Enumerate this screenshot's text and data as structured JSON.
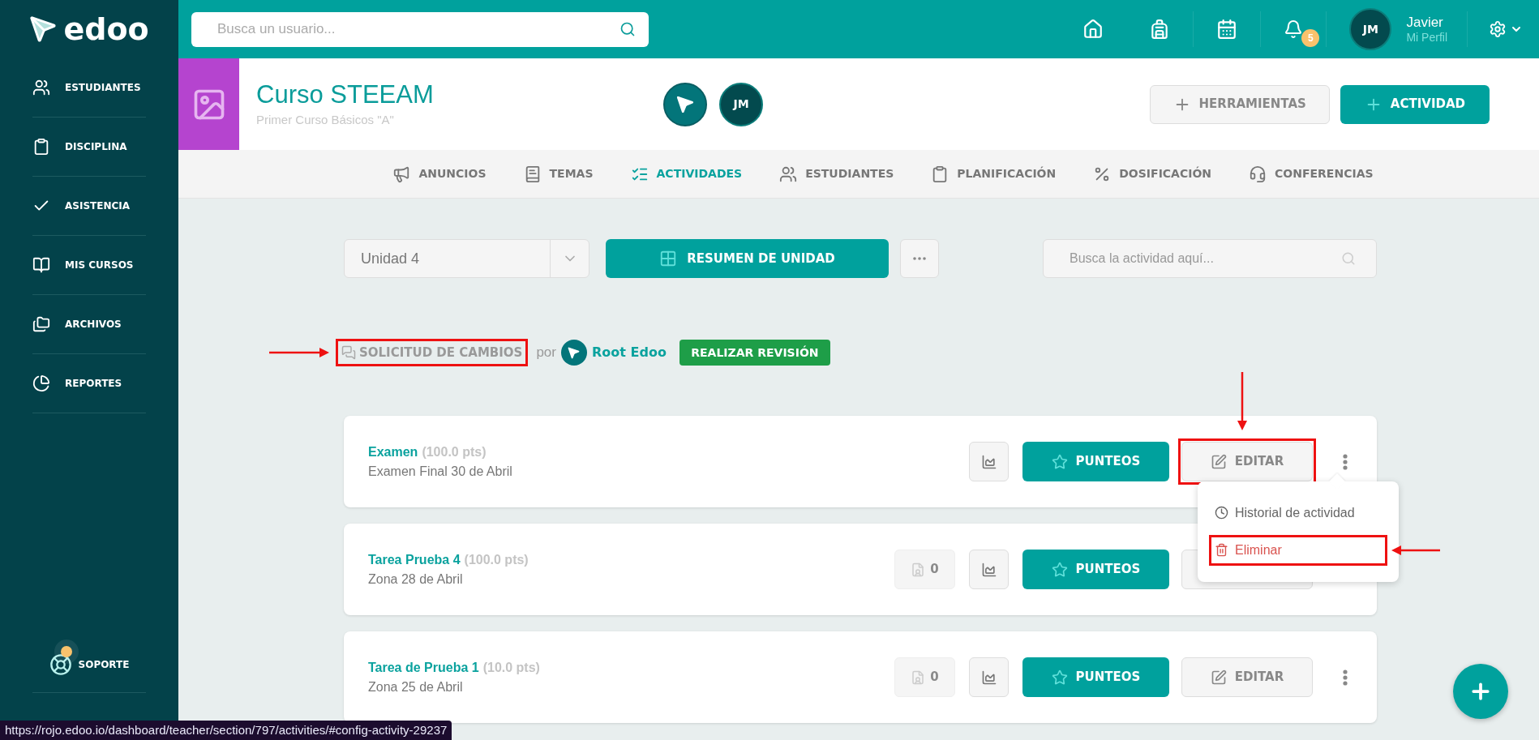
{
  "sidebar": {
    "logo": "edoo",
    "items": [
      {
        "label": "ESTUDIANTES"
      },
      {
        "label": "DISCIPLINA"
      },
      {
        "label": "ASISTENCIA"
      },
      {
        "label": "MIS CURSOS"
      },
      {
        "label": "ARCHIVOS"
      },
      {
        "label": "REPORTES"
      }
    ],
    "support": {
      "label": "SOPORTE",
      "notification": true
    }
  },
  "topbar": {
    "search": {
      "placeholder": "Busca un usuario..."
    },
    "notifications_badge": "5",
    "user": {
      "initials": "JM",
      "name": "Javier",
      "link": "Mi Perfil"
    }
  },
  "course": {
    "title": "Curso STEEAM",
    "subtitle": "Primer Curso Básicos \"A\"",
    "avatar_initials": "JM",
    "buttons": [
      {
        "label": "HERRAMIENTAS",
        "kind": "secondary"
      },
      {
        "label": "ACTIVIDAD",
        "kind": "primary"
      }
    ]
  },
  "tabs": [
    {
      "label": "ANUNCIOS",
      "selected": false
    },
    {
      "label": "TEMAS",
      "selected": false
    },
    {
      "label": "ACTIVIDADES",
      "selected": true
    },
    {
      "label": "ESTUDIANTES",
      "selected": false
    },
    {
      "label": "PLANIFICACIÓN",
      "selected": false
    },
    {
      "label": "DOSIFICACIÓN",
      "selected": false
    },
    {
      "label": "CONFERENCIAS",
      "selected": false
    }
  ],
  "toolbar": {
    "unit_select": "Unidad 4",
    "summary_button": "RESUMEN DE UNIDAD",
    "search": {
      "placeholder": "Busca la actividad aquí..."
    }
  },
  "change_request": {
    "label": "SOLICITUD DE CAMBIOS",
    "highlighted": true,
    "by": "por",
    "author": "Root Edoo",
    "review_button": "REALIZAR REVISIÓN"
  },
  "activities": [
    {
      "title": "Examen",
      "points": "(100.0 pts)",
      "description": "Examen Final 30 de Abril",
      "score_button": "PUNTEOS",
      "edit_button": {
        "label": "EDITAR",
        "highlighted": true
      },
      "more_options": true,
      "menu": [
        {
          "label": "Historial de actividad",
          "kind": "history",
          "highlighted": false
        },
        {
          "label": "Eliminar",
          "kind": "delete",
          "highlighted": true
        }
      ]
    },
    {
      "title": "Tarea Prueba 4",
      "points": "(100.0 pts)",
      "description": "Zona 28 de Abril",
      "submissions": "0",
      "score_button": "PUNTEOS",
      "edit_button": {
        "highlighted": false
      }
    },
    {
      "title": "Tarea de Prueba 1",
      "points": "(10.0 pts)",
      "description": "Zona 25 de Abril",
      "submissions": "0",
      "score_button": "PUNTEOS",
      "edit_button": {
        "label": "EDITAR",
        "highlighted": false
      },
      "more_options": true
    }
  ],
  "status_tooltip": "https://rojo.edoo.io/dashboard/teacher/section/797/activities/#config-activity-29237"
}
